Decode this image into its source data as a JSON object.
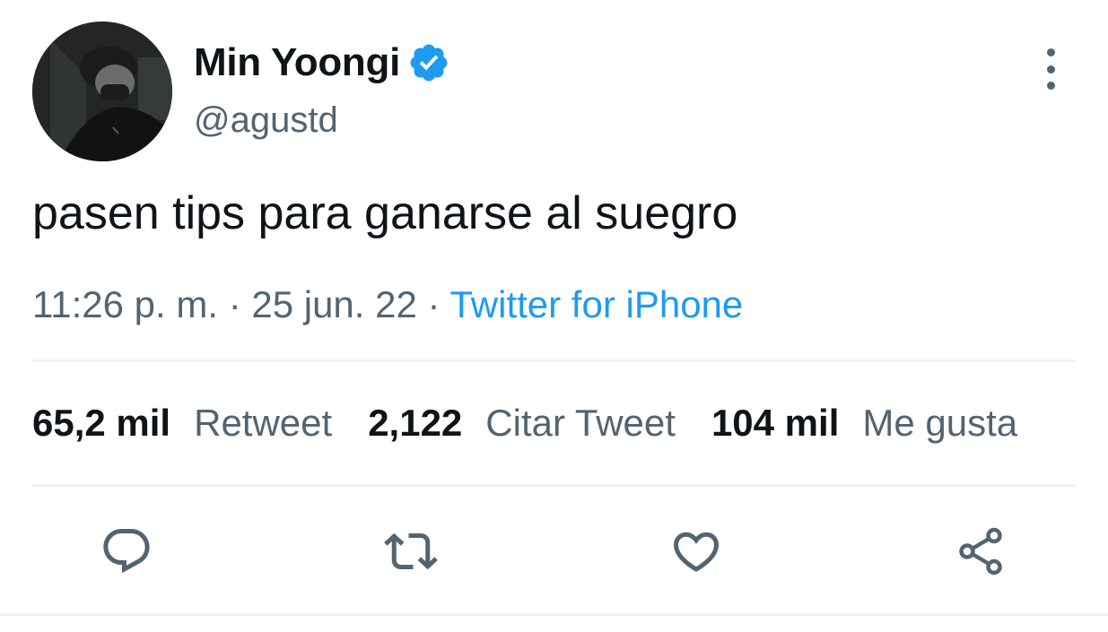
{
  "author": {
    "display_name": "Min Yoongi",
    "handle": "@agustd",
    "verified_icon": "verified-badge-icon",
    "avatar_icon": "profile-photo"
  },
  "tweet": {
    "text": "pasen tips para ganarse al suegro",
    "time": "11:26 p. m.",
    "separator": "·",
    "date": "25 jun. 22",
    "source": "Twitter for iPhone"
  },
  "stats": {
    "retweets": {
      "count": "65,2 mil",
      "label": "Retweet"
    },
    "quotes": {
      "count": "2,122",
      "label": "Citar Tweet"
    },
    "likes": {
      "count": "104 mil",
      "label": "Me gusta"
    }
  },
  "actions": [
    "reply-icon",
    "retweet-icon",
    "like-icon",
    "share-icon"
  ],
  "colors": {
    "text_primary": "#0f1419",
    "text_secondary": "#536471",
    "accent": "#1d9bf0",
    "divider": "#eff3f4"
  }
}
